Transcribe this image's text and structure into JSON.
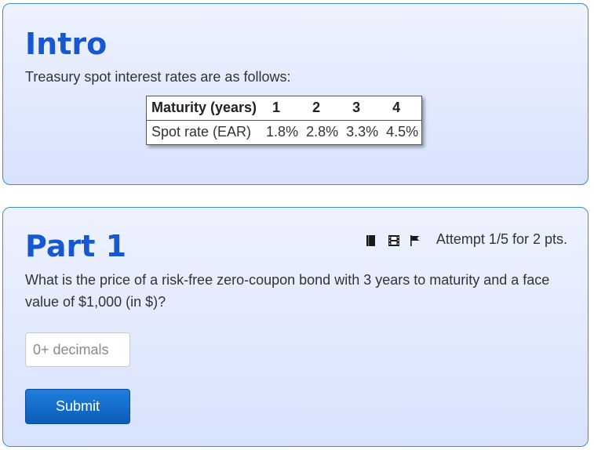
{
  "intro": {
    "title": "Intro",
    "text": "Treasury spot interest rates are as follows:",
    "table": {
      "headers": [
        "Maturity (years)",
        "1",
        "2",
        "3",
        "4"
      ],
      "rows": [
        [
          "Spot rate (EAR)",
          "1.8%",
          "2.8%",
          "3.3%",
          "4.5%"
        ]
      ]
    }
  },
  "part1": {
    "title": "Part 1",
    "icons": [
      "book-icon",
      "film-icon",
      "flag-icon"
    ],
    "attempt_text": "Attempt 1/5 for 2 pts.",
    "question": "What is the price of a risk-free zero-coupon bond with 3 years to maturity and a face value of $1,000 (in $)?",
    "input": {
      "value": "",
      "placeholder": "0+ decimals"
    },
    "submit_label": "Submit"
  },
  "colors": {
    "title_blue": "#1757d2",
    "card_border": "#3e8ec8",
    "card_bg_top": "#eef2fe",
    "card_bg_bottom": "#d7e2fc",
    "button_blue": "#0a5db8"
  }
}
